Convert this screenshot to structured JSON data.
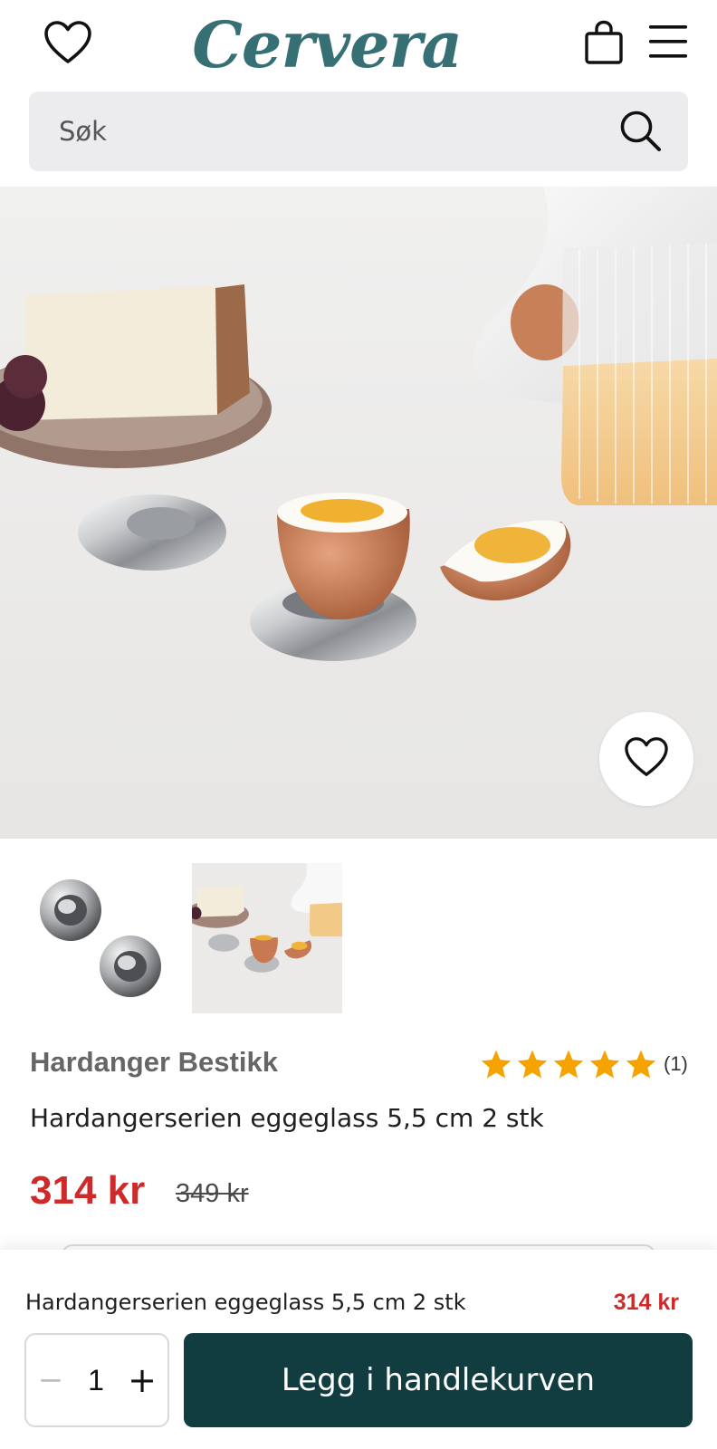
{
  "header": {
    "logo": "Cervera",
    "wishlist_icon": "heart-outline-icon",
    "bag_icon": "shopping-bag-icon",
    "menu_icon": "hamburger-menu-icon"
  },
  "search": {
    "placeholder": "Søk",
    "icon": "search-icon"
  },
  "gallery": {
    "hero_fav_icon": "heart-outline-icon",
    "thumbnail_count": 2
  },
  "product": {
    "brand": "Hardanger Bestikk",
    "rating": {
      "stars": 5,
      "count": "(1)",
      "star_color": "#f5a300"
    },
    "title": "Hardangerserien eggeglass 5,5 cm 2 stk",
    "price": "314 kr",
    "old_price": "349 kr"
  },
  "sticky_bar": {
    "title": "Hardangerserien eggeglass 5,5 cm 2 stk",
    "price": "314 kr",
    "quantity": "1",
    "minus": "−",
    "plus": "+",
    "add_to_cart": "Legg i handlekurven"
  },
  "colors": {
    "brand_teal": "#367074",
    "button_dark": "#113d40",
    "price_red": "#cf2a2a",
    "search_bg": "#ececee"
  }
}
